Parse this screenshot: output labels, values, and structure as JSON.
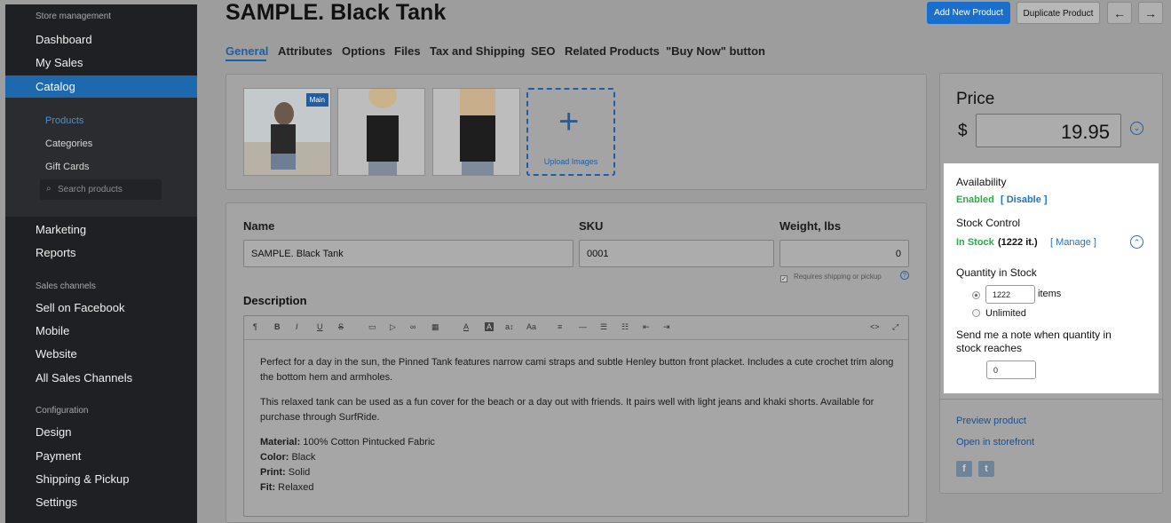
{
  "sidebar": {
    "section_store": "Store management",
    "items_store": [
      "Dashboard",
      "My Sales"
    ],
    "active_item": "Catalog",
    "catalog_sub": [
      "Products",
      "Categories",
      "Gift Cards"
    ],
    "search_placeholder": "Search products",
    "items_after": [
      "Marketing",
      "Reports"
    ],
    "section_sales": "Sales channels",
    "items_sales": [
      "Sell on Facebook",
      "Mobile",
      "Website",
      "All Sales Channels"
    ],
    "section_config": "Configuration",
    "items_config": [
      "Design",
      "Payment",
      "Shipping & Pickup",
      "Settings"
    ]
  },
  "header": {
    "title": "SAMPLE. Black Tank",
    "new_product": "Add New Product",
    "duplicate_product": "Duplicate Product",
    "prev": "←",
    "next": "→"
  },
  "tabs": [
    "General",
    "Attributes",
    "Options",
    "Files",
    "Tax and Shipping",
    "SEO",
    "Related Products",
    "\"Buy Now\" button"
  ],
  "images": {
    "main_badge": "Main",
    "upload_label": "Upload Images"
  },
  "fields": {
    "name_label": "Name",
    "name_value": "SAMPLE. Black Tank",
    "sku_label": "SKU",
    "sku_value": "0001",
    "weight_label": "Weight, lbs",
    "weight_value": "0",
    "requires_shipping": "Requires shipping or pickup"
  },
  "description": {
    "label": "Description",
    "p1": "Perfect for a day in the sun, the Pinned Tank features narrow cami straps and subtle Henley button front placket. Includes a cute crochet trim along the bottom hem and armholes.",
    "p2": "This relaxed tank can be used as a fun cover for the beach or a day out with friends. It pairs well with light jeans and khaki shorts. Available for purchase through SurfRide.",
    "specs": [
      {
        "k": "Material:",
        "v": " 100% Cotton Pintucked Fabric"
      },
      {
        "k": "Color:",
        "v": " Black"
      },
      {
        "k": "Print:",
        "v": " Solid"
      },
      {
        "k": "Fit:",
        "v": " Relaxed"
      }
    ]
  },
  "price": {
    "title": "Price",
    "currency": "$",
    "value": "19.95"
  },
  "availability": {
    "title": "Availability",
    "status": "Enabled",
    "disable_link": "[ Disable ]",
    "stock_title": "Stock Control",
    "stock_status": "In Stock",
    "stock_count": "(1222 it.)",
    "manage_link": "[ Manage ]",
    "qty_title": "Quantity in Stock",
    "qty_value": "1222",
    "qty_unit": "items",
    "unlimited": "Unlimited",
    "note_title": "Send me a note when quantity in stock reaches",
    "note_value": "0"
  },
  "links": {
    "preview": "Preview product",
    "storefront": "Open in storefront"
  },
  "colors": {
    "accent": "#1a6fce",
    "enabled_green": "#2ea94a",
    "sidebar_bg": "#1f2024"
  }
}
